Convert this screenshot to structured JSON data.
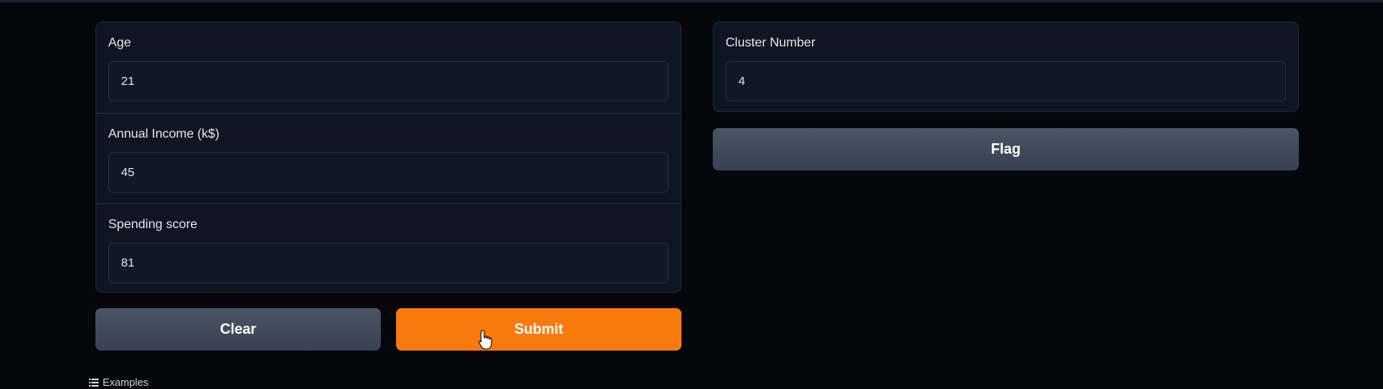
{
  "inputs": [
    {
      "label": "Age",
      "value": "21"
    },
    {
      "label": "Annual Income (k$)",
      "value": "45"
    },
    {
      "label": "Spending score",
      "value": "81"
    }
  ],
  "output": {
    "label": "Cluster Number",
    "value": "4"
  },
  "buttons": {
    "clear": "Clear",
    "submit": "Submit",
    "flag": "Flag"
  },
  "examples": {
    "label": "Examples",
    "icon": "list-icon"
  },
  "colors": {
    "submit": "#f97a0c",
    "background": "#05070c",
    "panel": "#0f1522"
  }
}
